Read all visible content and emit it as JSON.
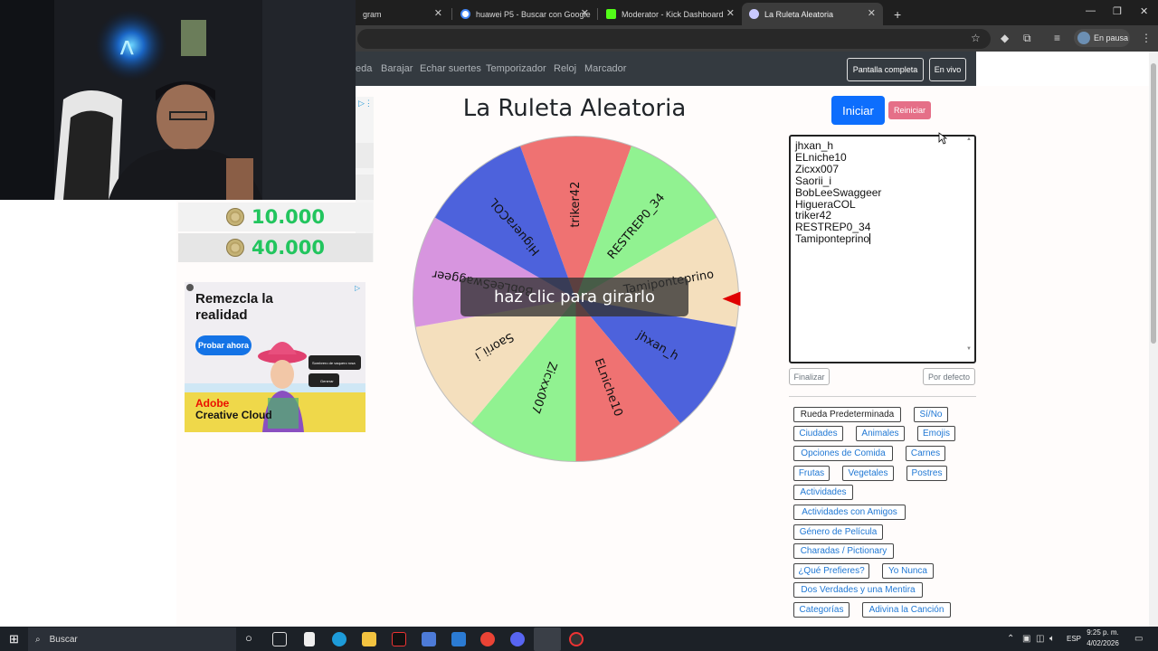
{
  "browser": {
    "tabs": [
      {
        "title": "gram"
      },
      {
        "title": "huawei P5 - Buscar con Google"
      },
      {
        "title": "Moderator - Kick Dashboard"
      },
      {
        "title": "La Ruleta Aleatoria"
      }
    ],
    "new_tab": "+",
    "profile_status": "En pausa"
  },
  "nav": {
    "links": [
      "eda",
      "Barajar",
      "Echar suertes",
      "Temporizador",
      "Reloj",
      "Marcador"
    ],
    "fullscreen": "Pantalla completa",
    "live": "En vivo"
  },
  "overlay": {
    "counter1": "10.000",
    "counter2": "40.000"
  },
  "ad": {
    "headline": "Remezcla la realidad",
    "cta": "Probar ahora",
    "brand_line1": "Adobe",
    "brand_line2": "Creative Cloud",
    "small_field": "Sombrero de vaquero rosa",
    "small_btn": "Generar"
  },
  "main": {
    "title": "La Ruleta Aleatoria",
    "spin_hint": "haz clic para girarlo",
    "start_label": "Iniciar",
    "reset_label": "Reiniciar",
    "names": [
      "jhxan_h",
      "ELniche10",
      "Zicxx007",
      "Saorii_i",
      "BobLeeSwaggeer",
      "HigueraCOL",
      "triker42",
      "RESTREP0_34",
      "Tamiponteprino"
    ],
    "finish_label": "Finalizar",
    "default_label": "Por defecto",
    "presets": [
      "Rueda Predeterminada",
      "Sí/No",
      "Ciudades",
      "Animales",
      "Emojis",
      "Opciones de Comida",
      "Carnes",
      "Frutas",
      "Vegetales",
      "Postres",
      "Actividades",
      "Actividades con Amigos",
      "Género de Película",
      "Charadas / Pictionary",
      "¿Qué Prefieres?",
      "Yo Nunca",
      "Dos Verdades y una Mentira",
      "Categorías",
      "Adivina la Canción"
    ]
  },
  "wheel": {
    "segments": [
      {
        "label": "triker42",
        "color": "#ef7272"
      },
      {
        "label": "RESTREP0_34",
        "color": "#91f291"
      },
      {
        "label": "Tamiponteprino",
        "color": "#f4dfbd"
      },
      {
        "label": "jhxan_h",
        "color": "#4d62dc"
      },
      {
        "label": "ELniche10",
        "color": "#ef7272"
      },
      {
        "label": "Zicxx007",
        "color": "#91f291"
      },
      {
        "label": "Saorii_i",
        "color": "#f4dfbd"
      },
      {
        "label": "BobLeeSwaggeer",
        "color": "#d795df"
      },
      {
        "label": "HigueraCOL",
        "color": "#4d62dc"
      }
    ],
    "pointer_color": "#e00000"
  },
  "taskbar": {
    "search": "Buscar",
    "lang": "ESP",
    "time": "9:25 p. m.",
    "date": "4/02/2026"
  }
}
